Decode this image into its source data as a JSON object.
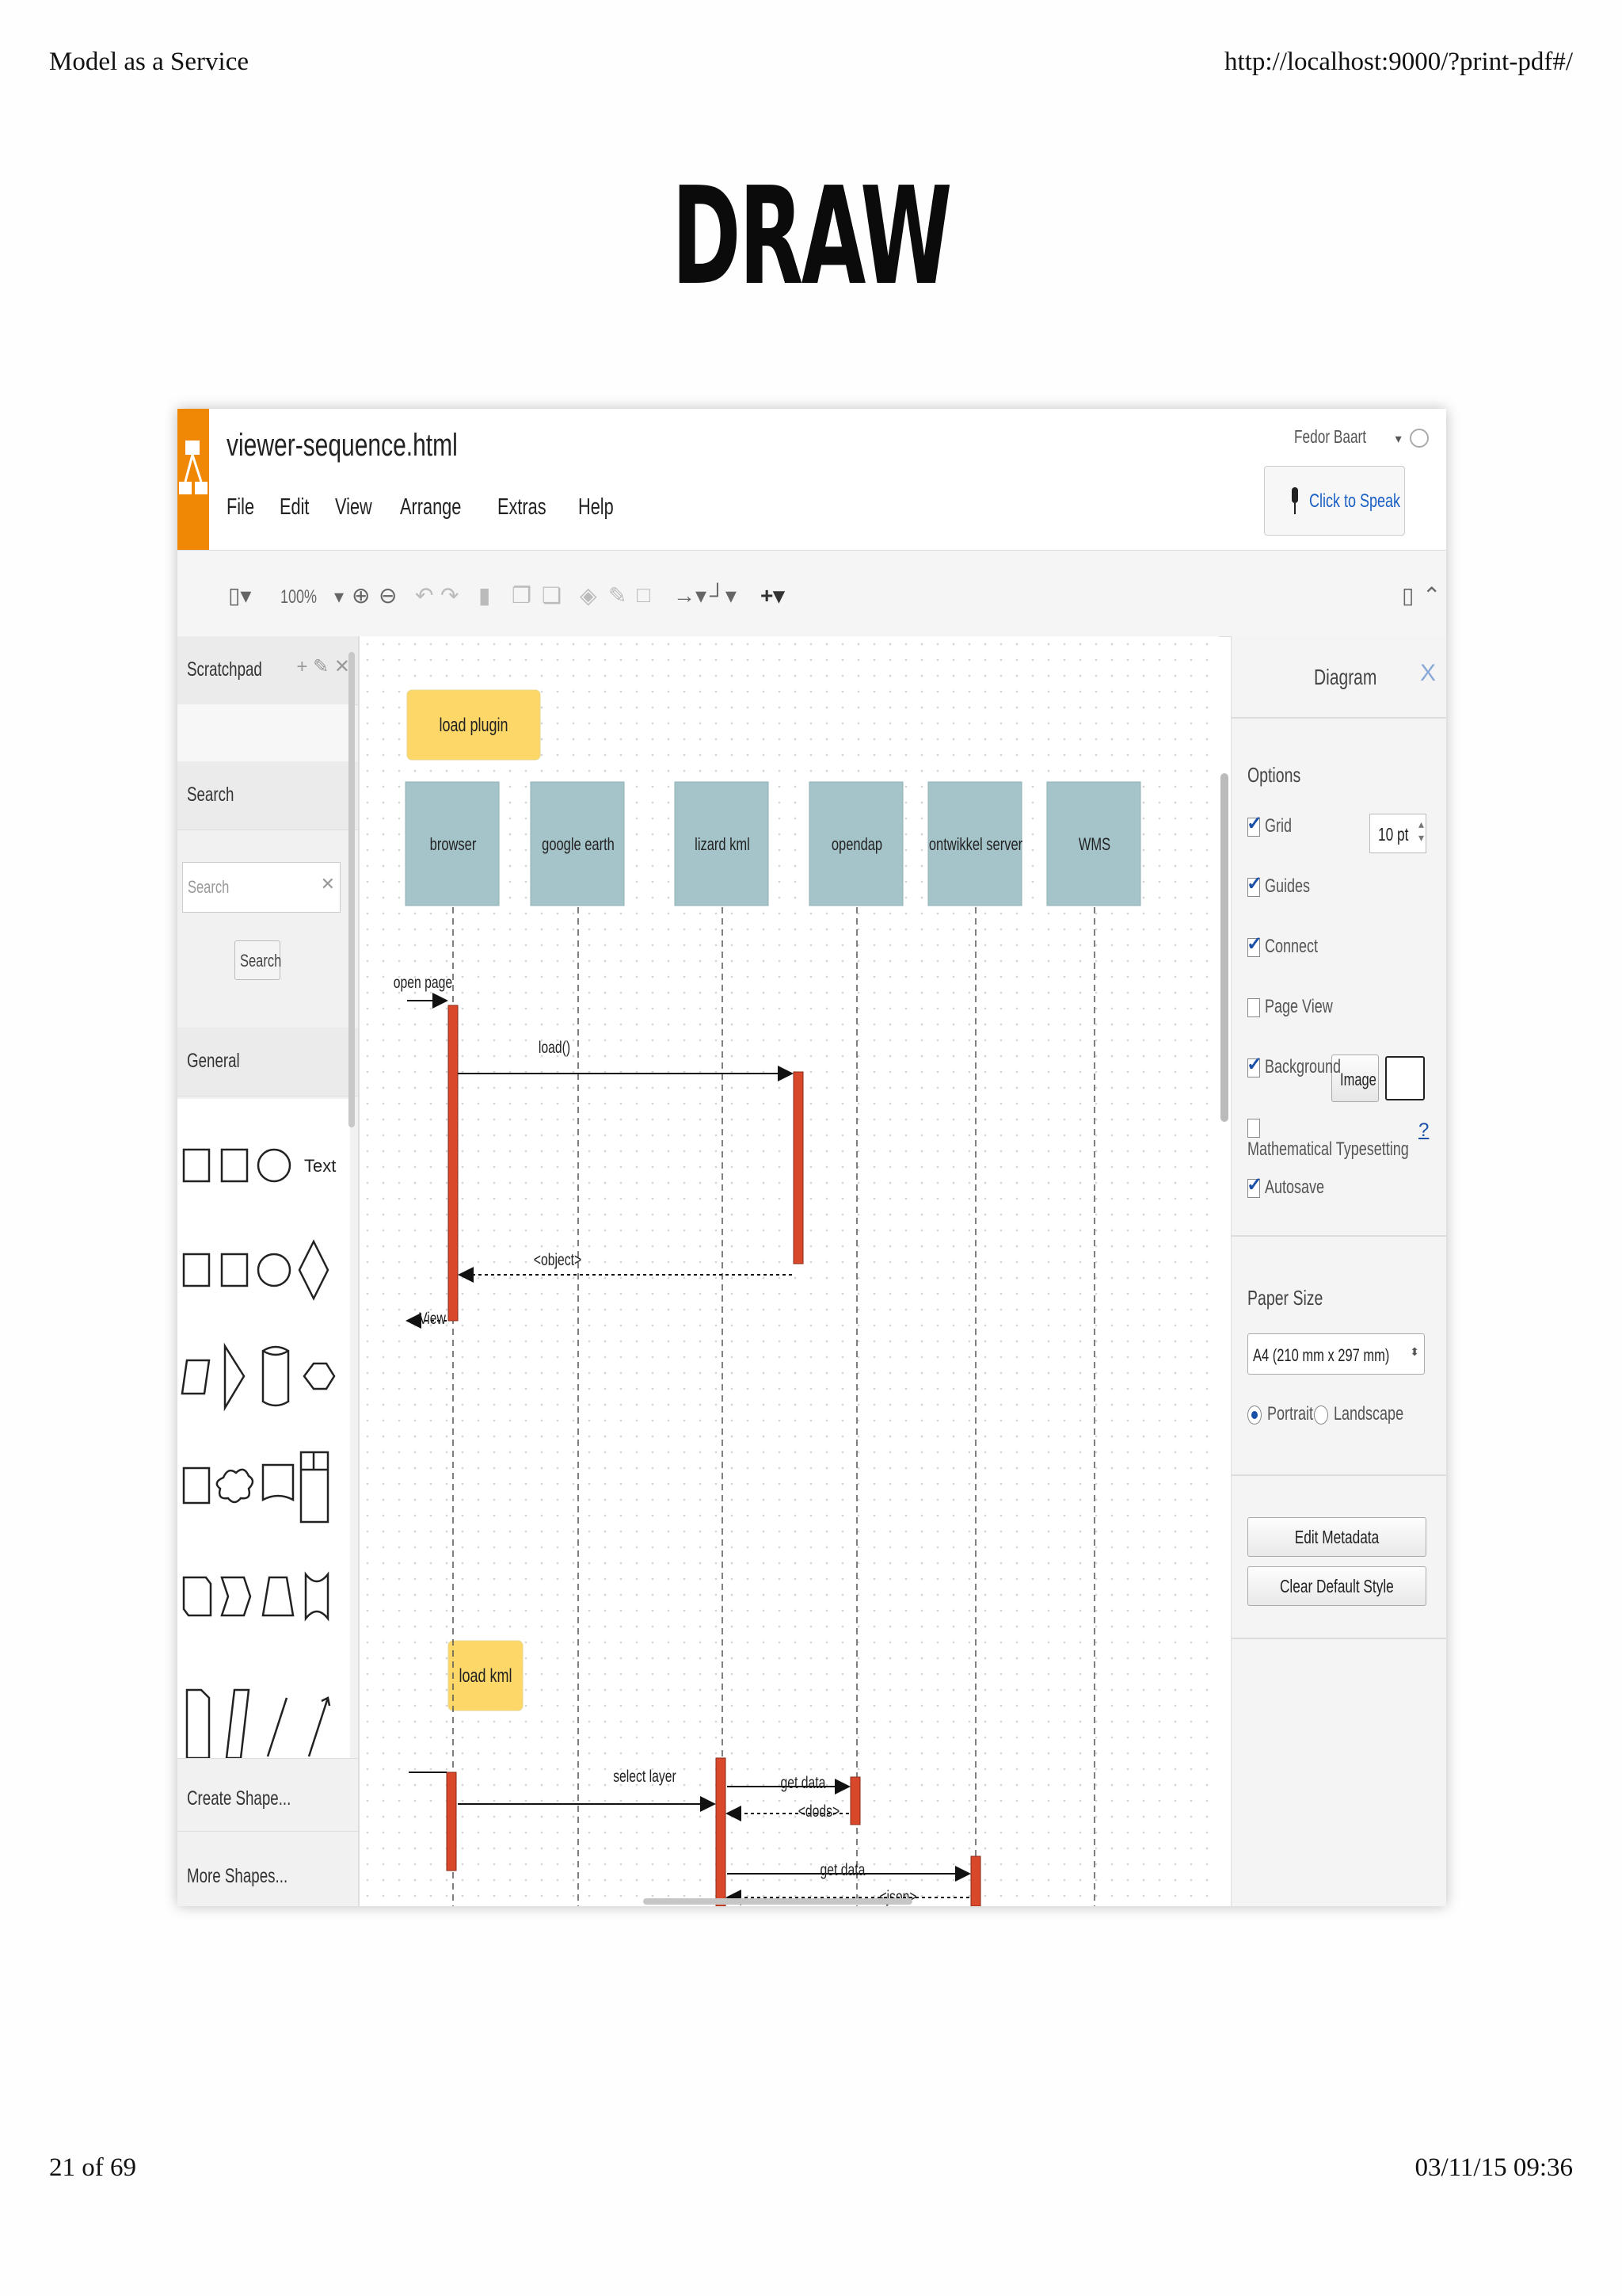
{
  "page_header": {
    "left": "Model as a Service",
    "right": "http://localhost:9000/?print-pdf#/"
  },
  "slide_title": "DRAW",
  "page_footer": {
    "left": "21 of 69",
    "right": "03/11/15 09:36"
  },
  "app": {
    "filename": "viewer-sequence.html",
    "menu": [
      "File",
      "Edit",
      "View",
      "Arrange",
      "Extras",
      "Help"
    ],
    "user": "Fedor Baart",
    "speak_button": "Click to Speak",
    "toolbar": {
      "zoom": "100%"
    },
    "left_panel": {
      "scratchpad": "Scratchpad",
      "search_section": "Search",
      "search_placeholder": "Search",
      "search_button": "Search",
      "general_section": "General",
      "text_shape": "Text",
      "create_shape": "Create Shape...",
      "more_shapes": "More Shapes..."
    },
    "diagram": {
      "notes": [
        "load plugin",
        "load kml"
      ],
      "lifelines": [
        "browser",
        "google earth",
        "lizard kml",
        "opendap",
        "ontwikkel server",
        "WMS"
      ],
      "messages": [
        "open page",
        "load()",
        "<object>",
        "View",
        "select layer",
        "get data",
        "<dods>",
        "get data",
        "<json>"
      ]
    },
    "right_panel": {
      "title": "Diagram",
      "close": "X",
      "options_label": "Options",
      "options": [
        {
          "label": "Grid",
          "checked": true
        },
        {
          "label": "Guides",
          "checked": true
        },
        {
          "label": "Connect",
          "checked": true
        },
        {
          "label": "Page View",
          "checked": false
        },
        {
          "label": "Background",
          "checked": true
        },
        {
          "label": "Mathematical Typesetting",
          "checked": false
        },
        {
          "label": "Autosave",
          "checked": true
        }
      ],
      "grid_size": "10 pt",
      "image_button": "Image",
      "help_link": "?",
      "paper_size_label": "Paper Size",
      "paper_size": "A4 (210 mm x 297 mm)",
      "portrait": "Portrait",
      "landscape": "Landscape",
      "edit_metadata": "Edit Metadata",
      "clear_default_style": "Clear Default Style"
    },
    "colors": {
      "accent": "#f08705",
      "lifeline_box": "#a5c4c9",
      "note": "#fdd869",
      "activation": "#d9482a"
    }
  }
}
